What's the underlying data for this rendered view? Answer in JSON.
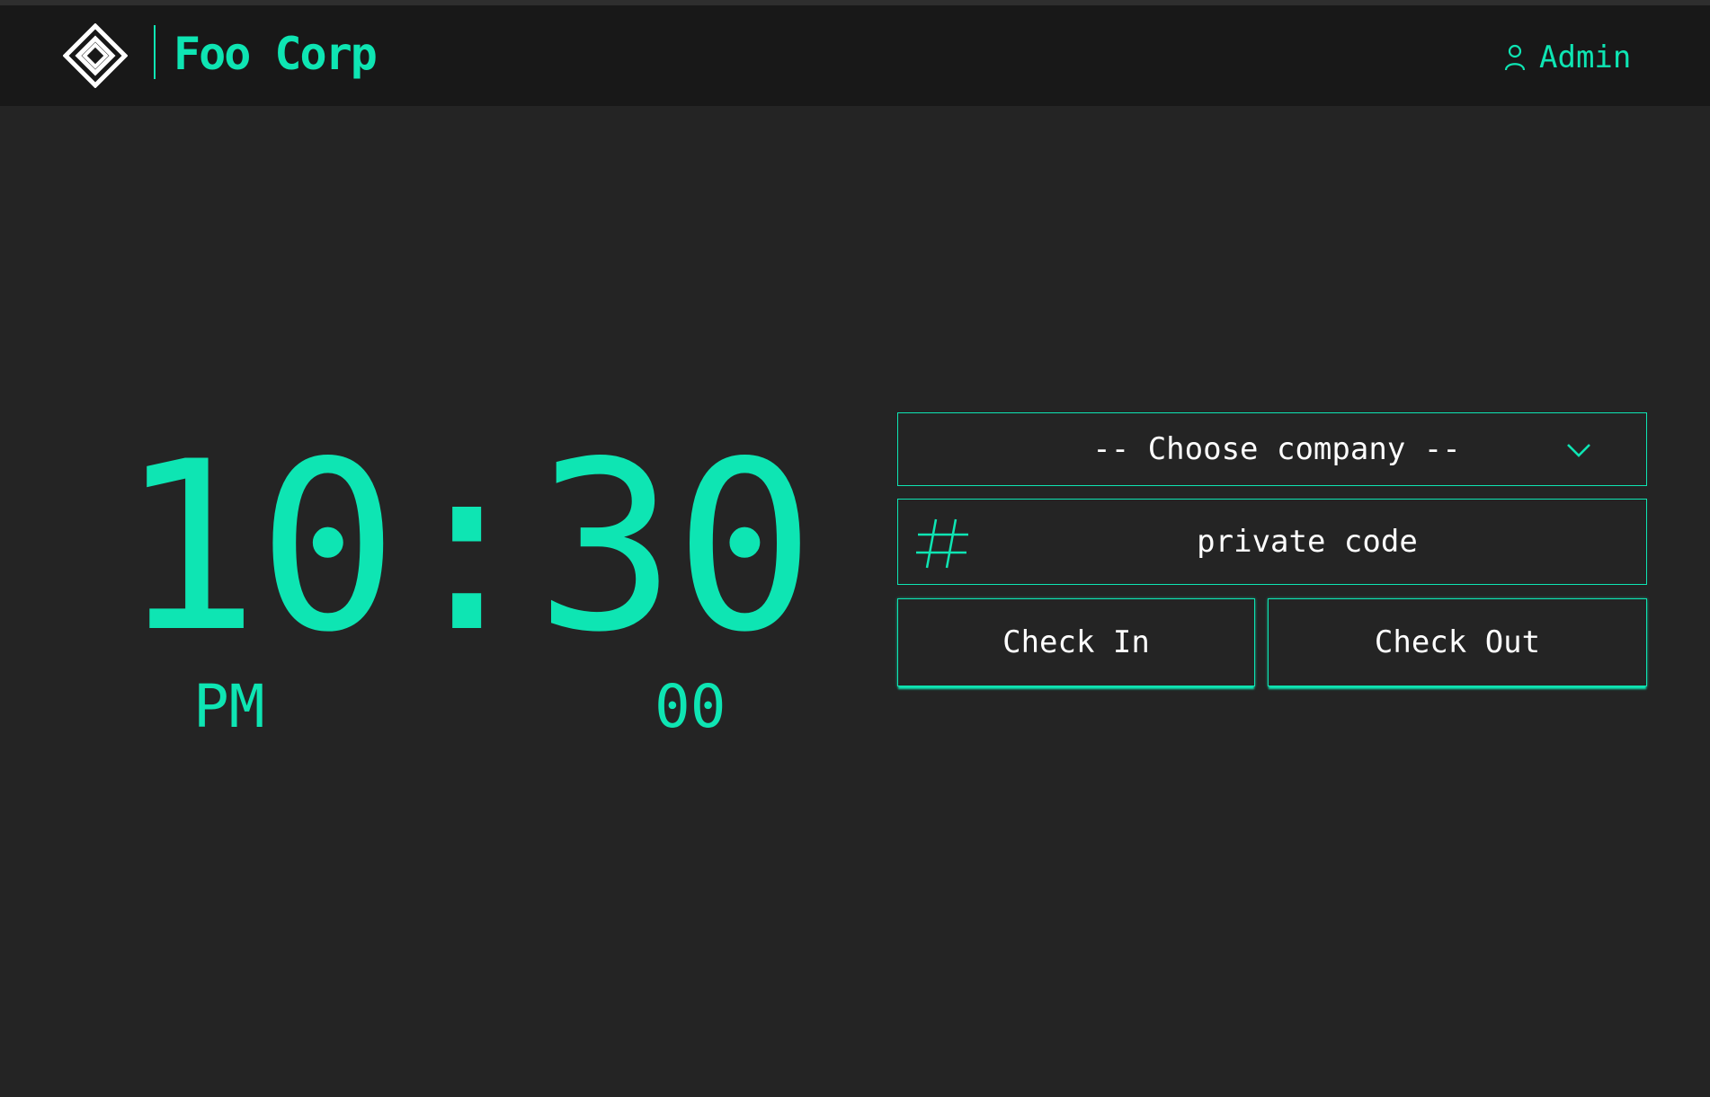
{
  "header": {
    "logo_icon": "diamond-logo-icon",
    "brand_name": "Foo Corp",
    "user_icon": "user-icon",
    "user_label": "Admin"
  },
  "clock": {
    "time": "10:30",
    "ampm": "PM",
    "seconds": "00"
  },
  "form": {
    "company_select": {
      "selected": "-- Choose company --",
      "icon": "chevron-down-icon"
    },
    "private_code": {
      "value": "",
      "placeholder": "private code",
      "icon": "hash-icon"
    },
    "check_in_label": "Check In",
    "check_out_label": "Check Out"
  },
  "colors": {
    "accent": "#0ee5b3",
    "background": "#242424",
    "header_background": "#181818",
    "button_text": "#ffffff"
  }
}
